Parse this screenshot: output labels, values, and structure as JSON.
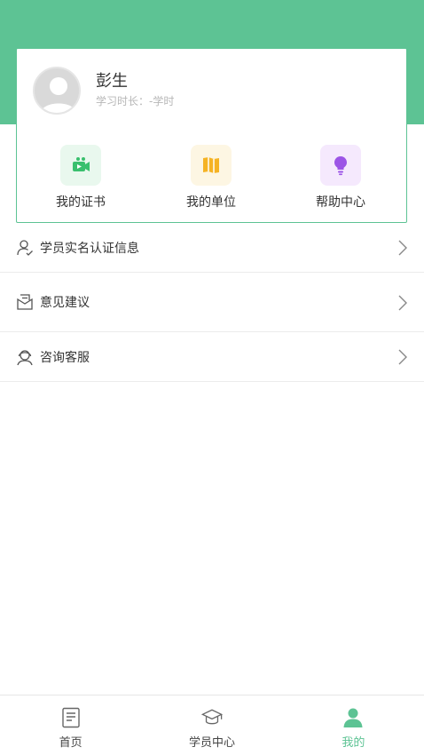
{
  "profile": {
    "name": "彭生",
    "study_time": "学习时长：-学时"
  },
  "quick_links": [
    {
      "label": "我的证书",
      "icon": "certificate-video-icon",
      "color": "#39c06e"
    },
    {
      "label": "我的单位",
      "icon": "map-book-icon",
      "color": "#f5b324"
    },
    {
      "label": "帮助中心",
      "icon": "lightbulb-icon",
      "color": "#9c55e6"
    }
  ],
  "menu": [
    {
      "label": "学员实名认证信息",
      "icon": "user-verify-icon"
    },
    {
      "label": "意见建议",
      "icon": "feedback-icon"
    },
    {
      "label": "咨询客服",
      "icon": "customer-service-icon"
    }
  ],
  "tabs": [
    {
      "label": "首页",
      "icon": "document-icon",
      "active": false
    },
    {
      "label": "学员中心",
      "icon": "graduation-cap-icon",
      "active": false
    },
    {
      "label": "我的",
      "icon": "person-icon",
      "active": true
    }
  ],
  "colors": {
    "accent": "#5dc394",
    "text": "#333333",
    "muted": "#b7b7b7"
  }
}
